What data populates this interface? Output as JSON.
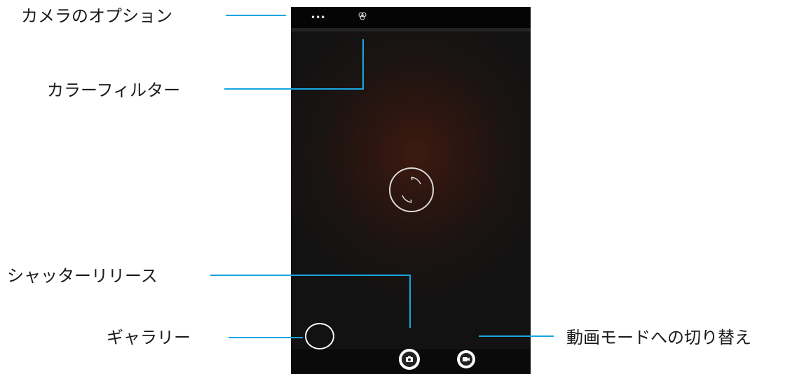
{
  "callouts": {
    "camera_options": "カメラのオプション",
    "color_filter": "カラーフィルター",
    "shutter_release": "シャッターリリース",
    "gallery": "ギャラリー",
    "video_switch": "動画モードへの切り替え"
  },
  "screen": {
    "more_icon_glyph": "•••",
    "icons": [
      "more-icon",
      "color-filter-icon",
      "focus-ring",
      "gallery-thumbnail",
      "camera-icon",
      "video-camera-icon"
    ]
  },
  "colors": {
    "callout_line": "#18a6e0",
    "label_text": "#1a1a1a",
    "screen_bg": "#121212",
    "viewfinder_glow": "#3d1a10"
  }
}
